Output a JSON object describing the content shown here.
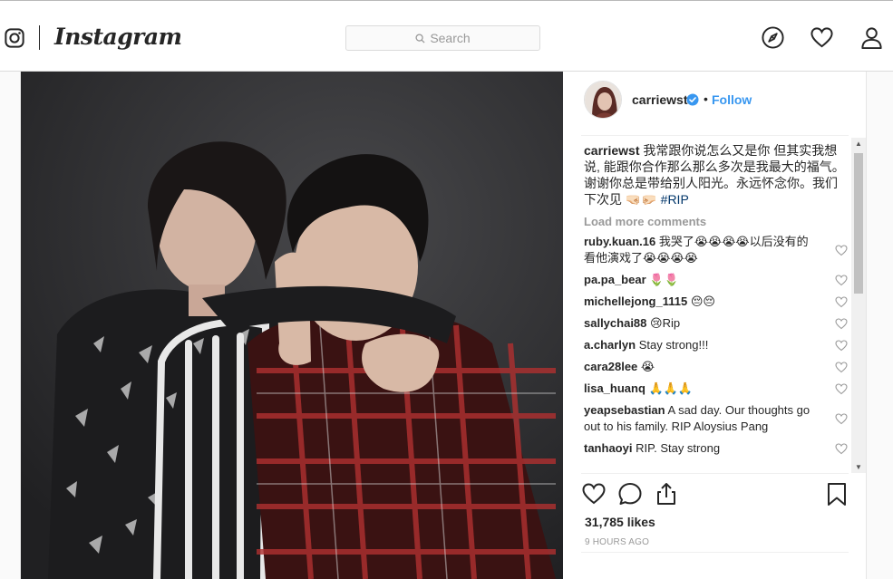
{
  "brand": {
    "wordmark": "Instagram"
  },
  "search": {
    "placeholder": "Search"
  },
  "post": {
    "username": "carriewst",
    "follow_label": "Follow",
    "dot": "•",
    "caption_user": "carriewst",
    "caption_text": "我常跟你说怎么又是你 但其实我想说, 能跟你合作那么那么多次是我最大的福气。谢谢你总是带给别人阳光。永远怀念你。我们下次见 🤜🏻🤛🏻 ",
    "caption_tag": "#RIP",
    "load_more": "Load more comments",
    "comments": [
      {
        "user": "ruby.kuan.16",
        "text": "我哭了😭😭😭😭以后没有的看他演戏了😭😭😭😭"
      },
      {
        "user": "pa.pa_bear",
        "text": "🌷🌷"
      },
      {
        "user": "michellejong_1115",
        "text": "😔😔"
      },
      {
        "user": "sallychai88",
        "text": "😢Rip"
      },
      {
        "user": "a.charlyn",
        "text": "Stay strong!!!"
      },
      {
        "user": "cara28lee",
        "text": "😭"
      },
      {
        "user": "lisa_huanq",
        "text": "🙏🙏🙏"
      },
      {
        "user": "yeapsebastian",
        "text": "A sad day. Our thoughts go out to his family. RIP Aloysius Pang"
      },
      {
        "user": "tanhaoyi",
        "text": "RIP. Stay strong"
      }
    ],
    "likes": "31,785 likes",
    "time_ago": "9 HOURS AGO"
  },
  "icons": {
    "instagram": "instagram-glyph-icon",
    "search": "search-icon",
    "explore": "compass-icon",
    "activity": "heart-icon",
    "profile": "person-icon",
    "verified": "verified-badge-icon",
    "like": "heart-outline-icon",
    "comment": "comment-bubble-icon",
    "share": "share-icon",
    "save": "bookmark-icon"
  },
  "colors": {
    "link": "#3897f0",
    "verified": "#3897f0",
    "text": "#262626",
    "muted": "#999999"
  }
}
